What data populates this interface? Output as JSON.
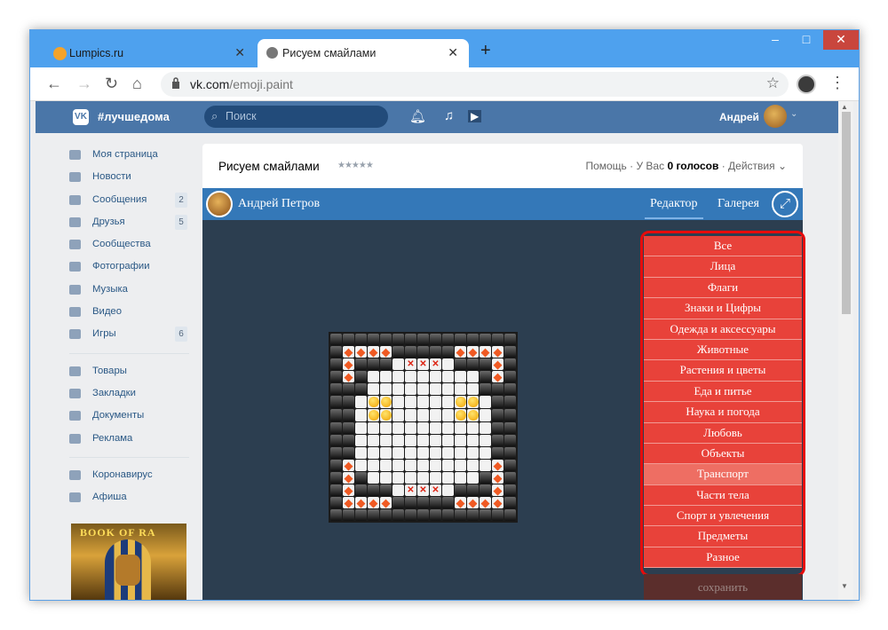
{
  "browser": {
    "tabs": [
      {
        "label": "Lumpics.ru"
      },
      {
        "label": "Рисуем смайлами"
      }
    ],
    "url_domain": "vk.com",
    "url_path": "/emoji.paint"
  },
  "vk": {
    "hashtag": "#лучшедома",
    "search_placeholder": "Поиск",
    "user": "Андрей"
  },
  "sidebar": {
    "items": [
      {
        "label": "Моя страница",
        "icon": "home-icon"
      },
      {
        "label": "Новости",
        "icon": "news-icon"
      },
      {
        "label": "Сообщения",
        "icon": "messages-icon",
        "count": "2"
      },
      {
        "label": "Друзья",
        "icon": "friends-icon",
        "count": "5"
      },
      {
        "label": "Сообщества",
        "icon": "groups-icon"
      },
      {
        "label": "Фотографии",
        "icon": "camera-icon"
      },
      {
        "label": "Музыка",
        "icon": "music-icon"
      },
      {
        "label": "Видео",
        "icon": "video-icon"
      },
      {
        "label": "Игры",
        "icon": "games-icon",
        "count": "6"
      },
      {
        "label": "Товары",
        "icon": "goods-icon"
      },
      {
        "label": "Закладки",
        "icon": "star-icon"
      },
      {
        "label": "Документы",
        "icon": "document-icon"
      },
      {
        "label": "Реклама",
        "icon": "ads-icon"
      },
      {
        "label": "Коронавирус",
        "icon": "virus-icon"
      },
      {
        "label": "Афиша",
        "icon": "afisha-icon"
      }
    ],
    "ad_title": "BOOK OF RA"
  },
  "app": {
    "title": "Рисуем смайлами",
    "rating": "★★★★★",
    "help": "Помощь",
    "votes_prefix": "· У Вас",
    "votes_value": "0 голосов",
    "actions": "· Действия ⌄",
    "author": "Андрей Петров",
    "tab_editor": "Редактор",
    "tab_gallery": "Галерея",
    "save": "сохранить",
    "categories": [
      "Все",
      "Лица",
      "Флаги",
      "Знаки и Цифры",
      "Одежда и аксессуары",
      "Животные",
      "Растения и цветы",
      "Еда и питье",
      "Наука и погода",
      "Любовь",
      "Объекты",
      "Транспорт",
      "Части тела",
      "Спорт и увлечения",
      "Предметы",
      "Разное"
    ],
    "selected_category": "Транспорт"
  },
  "colors": {
    "vk_header": "#4a76a8",
    "app_header": "#3478b8",
    "canvas_bg": "#2c3e50",
    "category_bg": "#e8423a",
    "highlight_border": "#e80b0b"
  }
}
